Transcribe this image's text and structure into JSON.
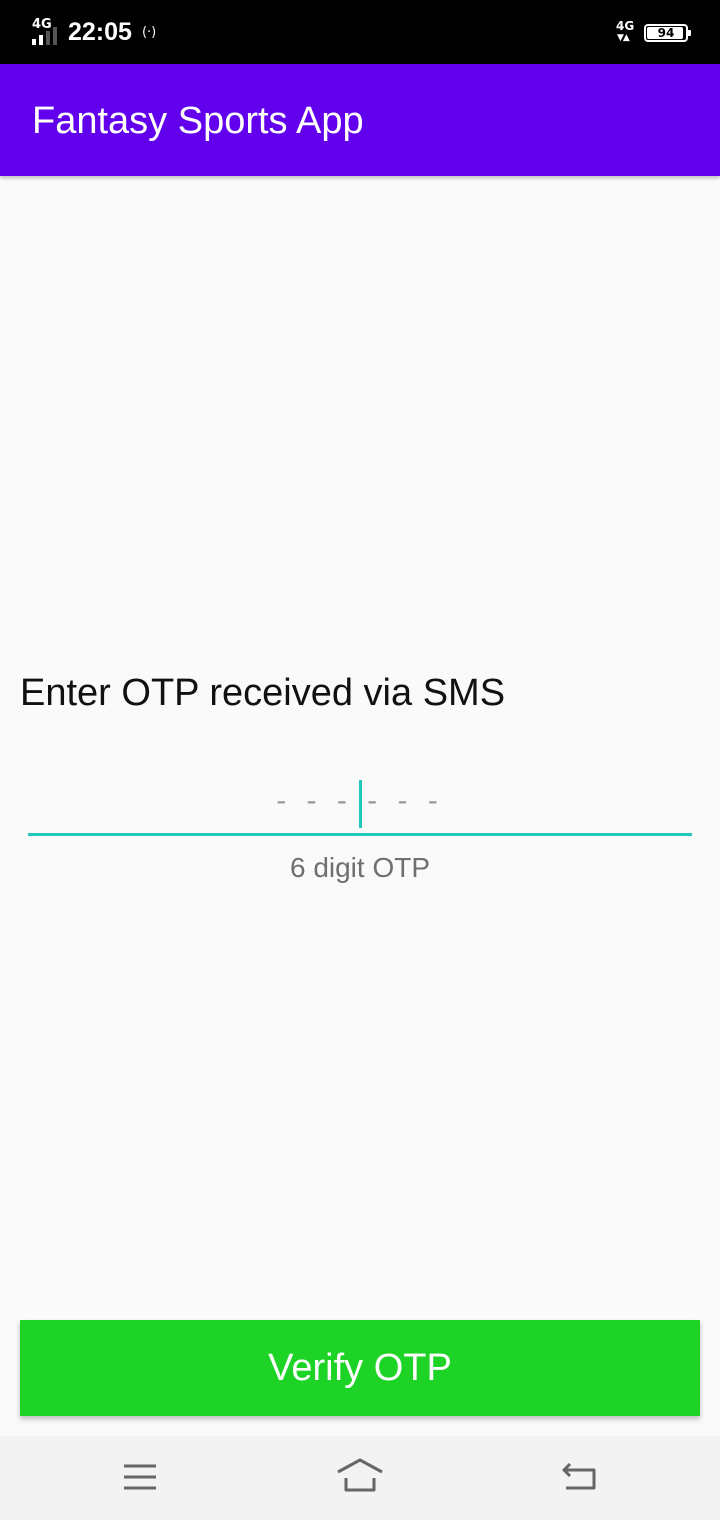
{
  "status_bar": {
    "network_left": "4G",
    "time": "22:05",
    "hotspot_icon": "(·)",
    "network_right": "4G",
    "network_right_arrows": "▼▲",
    "battery_level": "94",
    "battery_fraction": 0.94
  },
  "app_bar": {
    "title": "Fantasy Sports App"
  },
  "otp": {
    "prompt": "Enter OTP received via SMS",
    "placeholder": "- - - - - -",
    "helper": "6 digit OTP",
    "accent_color": "#1fc8b8"
  },
  "actions": {
    "verify_label": "Verify OTP",
    "verify_color": "#1dd325"
  },
  "nav_bar": {
    "icons": [
      "menu-icon",
      "home-icon",
      "back-icon"
    ]
  },
  "colors": {
    "app_bar": "#6200ee",
    "background": "#fafafa",
    "status_bar": "#000000"
  }
}
